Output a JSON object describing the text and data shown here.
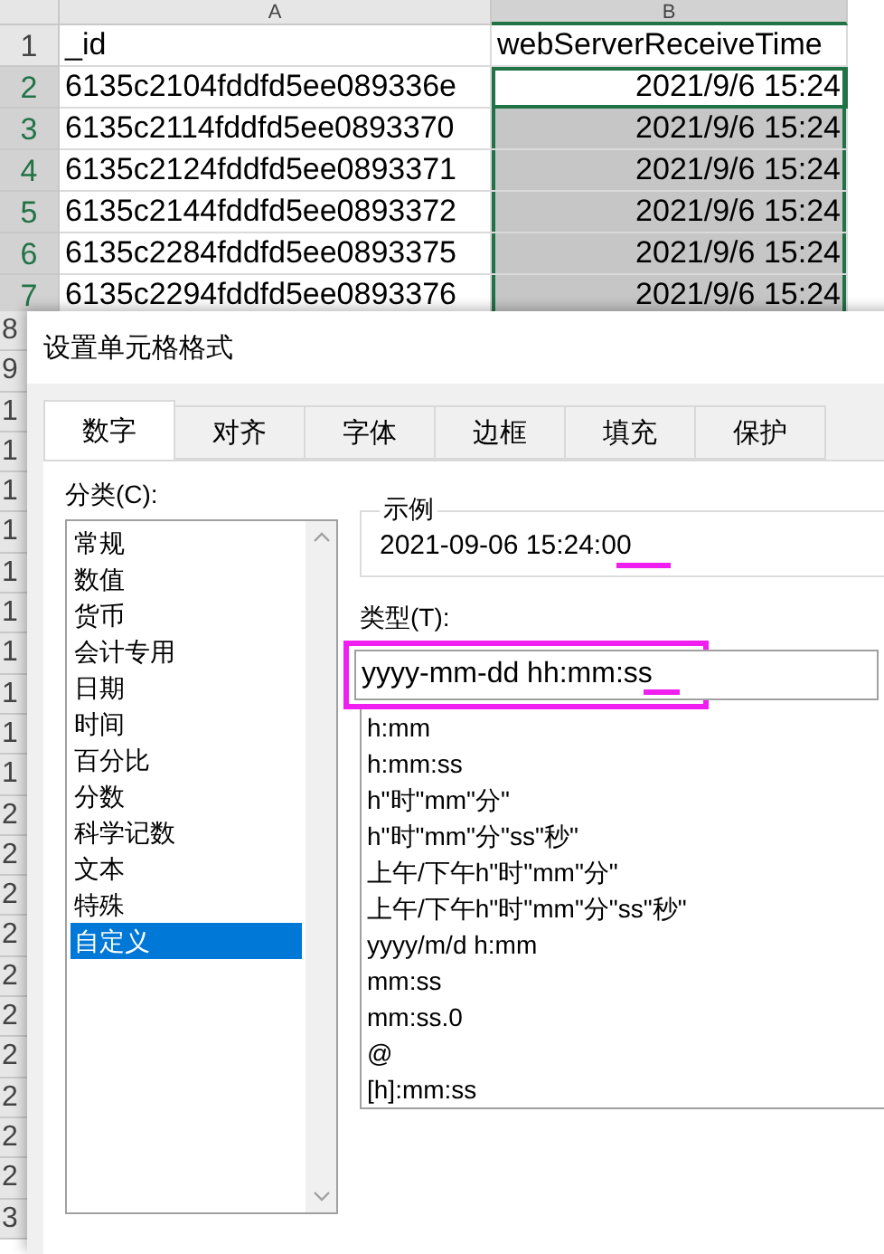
{
  "sheet": {
    "columns": [
      "A",
      "B"
    ],
    "rows": [
      {
        "number": "1",
        "a": "_id",
        "b": "webServerReceiveTime",
        "in_range": false,
        "active": false
      },
      {
        "number": "2",
        "a": "6135c2104fddfd5ee089336e",
        "b": "2021/9/6 15:24",
        "in_range": true,
        "active": true
      },
      {
        "number": "3",
        "a": "6135c2114fddfd5ee0893370",
        "b": "2021/9/6 15:24",
        "in_range": true,
        "active": false
      },
      {
        "number": "4",
        "a": "6135c2124fddfd5ee0893371",
        "b": "2021/9/6 15:24",
        "in_range": true,
        "active": false
      },
      {
        "number": "5",
        "a": "6135c2144fddfd5ee0893372",
        "b": "2021/9/6 15:24",
        "in_range": true,
        "active": false
      },
      {
        "number": "6",
        "a": "6135c2284fddfd5ee0893375",
        "b": "2021/9/6 15:24",
        "in_range": true,
        "active": false
      },
      {
        "number": "7",
        "a": "6135c2294fddfd5ee0893376",
        "b": "2021/9/6 15:24",
        "in_range": true,
        "active": false
      }
    ],
    "hidden_row_digits": [
      "8",
      "9",
      "1",
      "1",
      "1",
      "1",
      "1",
      "1",
      "1",
      "1",
      "1",
      "1",
      "2",
      "2",
      "2",
      "2",
      "2",
      "2",
      "2",
      "2",
      "2",
      "2",
      "3"
    ]
  },
  "dialog": {
    "title": "设置单元格格式",
    "tabs": [
      {
        "label": "数字",
        "selected": true
      },
      {
        "label": "对齐",
        "selected": false
      },
      {
        "label": "字体",
        "selected": false
      },
      {
        "label": "边框",
        "selected": false
      },
      {
        "label": "填充",
        "selected": false
      },
      {
        "label": "保护",
        "selected": false
      }
    ],
    "category_label": "分类(C):",
    "categories": [
      {
        "label": "常规",
        "selected": false
      },
      {
        "label": "数值",
        "selected": false
      },
      {
        "label": "货币",
        "selected": false
      },
      {
        "label": "会计专用",
        "selected": false
      },
      {
        "label": "日期",
        "selected": false
      },
      {
        "label": "时间",
        "selected": false
      },
      {
        "label": "百分比",
        "selected": false
      },
      {
        "label": "分数",
        "selected": false
      },
      {
        "label": "科学记数",
        "selected": false
      },
      {
        "label": "文本",
        "selected": false
      },
      {
        "label": "特殊",
        "selected": false
      },
      {
        "label": "自定义",
        "selected": true
      }
    ],
    "sample_label": "示例",
    "sample_value": "2021-09-06 15:24:00",
    "type_label": "类型(T):",
    "type_value": "yyyy-mm-dd hh:mm:ss",
    "type_options": [
      "h:mm",
      "h:mm:ss",
      "h\"时\"mm\"分\"",
      "h\"时\"mm\"分\"ss\"秒\"",
      "上午/下午h\"时\"mm\"分\"",
      "上午/下午h\"时\"mm\"分\"ss\"秒\"",
      "yyyy/m/d h:mm",
      "mm:ss",
      "mm:ss.0",
      "@",
      "[h]:mm:ss"
    ]
  }
}
